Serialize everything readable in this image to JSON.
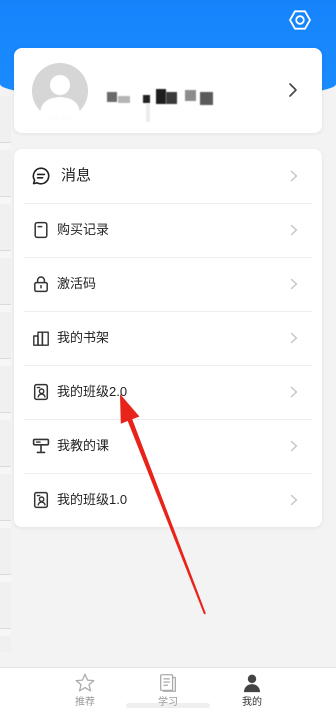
{
  "header": {
    "settings_icon": "gear-icon"
  },
  "profile": {
    "avatar_icon": "avatar-placeholder-icon",
    "chevron_icon": "chevron-right-icon"
  },
  "menu": {
    "chevron_icon": "chevron-right-icon",
    "items": [
      {
        "label": "消息",
        "icon": "message-icon"
      },
      {
        "label": "购买记录",
        "icon": "receipt-icon"
      },
      {
        "label": "激活码",
        "icon": "lock-icon"
      },
      {
        "label": "我的书架",
        "icon": "bookshelf-icon"
      },
      {
        "label": "我的班级2.0",
        "icon": "class-badge-icon"
      },
      {
        "label": "我教的课",
        "icon": "lectern-icon"
      },
      {
        "label": "我的班级1.0",
        "icon": "class-badge-icon"
      }
    ]
  },
  "tabbar": {
    "tabs": [
      {
        "label": "推荐",
        "icon": "star-icon",
        "active": false
      },
      {
        "label": "学习",
        "icon": "book-icon",
        "active": false
      },
      {
        "label": "我的",
        "icon": "person-icon",
        "active": true
      }
    ]
  },
  "annotation": {
    "icon": "red-arrow-icon",
    "color": "#e8231a"
  },
  "colors": {
    "header_blue": "#1a8cff",
    "annotation_red": "#e8231a",
    "active_tab": "#444444",
    "inactive_tab": "#9a9a9a",
    "text": "#222222"
  }
}
